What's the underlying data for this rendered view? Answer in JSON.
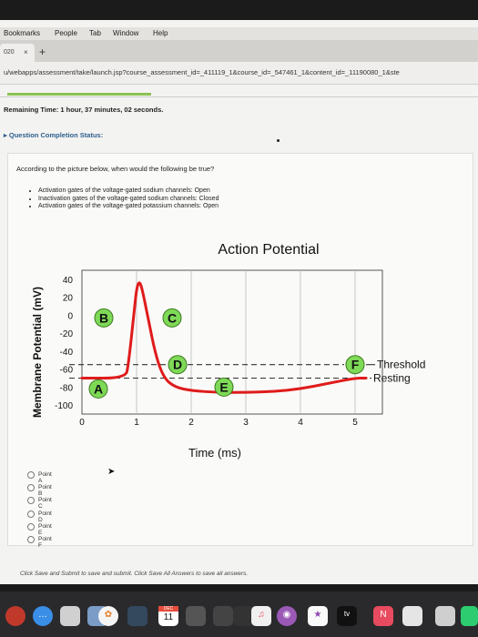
{
  "menubar": [
    "Bookmarks",
    "People",
    "Tab",
    "Window",
    "Help"
  ],
  "tab": {
    "label": "020",
    "close": "×",
    "new_tab": "+"
  },
  "url": "u/webapps/assessment/take/launch.jsp?course_assessment_id=_411119_1&course_id=_547461_1&content_id=_11190080_1&ste",
  "remaining_label": "Remaining Time:",
  "remaining_value": "1 hour, 37 minutes, 02 seconds.",
  "completion_label": "Question Completion Status:",
  "question": {
    "prompt": "According to the picture below, when would the following be true?",
    "conditions": [
      "Activation gates of the voltage-gated sodium channels: Open",
      "Inactivation gates of the voltage-gated sodium channels: Closed",
      "Activation gates of the voltage-gated potassium channels: Open"
    ],
    "options": [
      "Point A",
      "Point B",
      "Point C",
      "Point D",
      "Point E",
      "Point F"
    ]
  },
  "chart_data": {
    "type": "line",
    "title": "Action Potential",
    "xlabel": "Time (ms)",
    "ylabel": "Membrane Potential (mV)",
    "xlim": [
      0,
      5.5
    ],
    "ylim": [
      -110,
      50
    ],
    "x_ticks": [
      "0",
      "1",
      "2",
      "3",
      "4",
      "5"
    ],
    "y_ticks": [
      "40",
      "20",
      "0",
      "-20",
      "-40",
      "-60",
      "-80",
      "-100"
    ],
    "threshold_mV": -55,
    "resting_mV": -70,
    "threshold_label": "Threshold",
    "resting_label": "Resting",
    "curve_color": "#e01b1b",
    "label_color": "#7ed957",
    "points": [
      {
        "label": "A",
        "x": 0.3,
        "y": -82
      },
      {
        "label": "B",
        "x": 0.4,
        "y": -3
      },
      {
        "label": "C",
        "x": 1.65,
        "y": -3
      },
      {
        "label": "D",
        "x": 1.75,
        "y": -55
      },
      {
        "label": "E",
        "x": 2.6,
        "y": -80
      },
      {
        "label": "F",
        "x": 5.0,
        "y": -55
      }
    ],
    "curve": [
      [
        0,
        -70
      ],
      [
        0.8,
        -70
      ],
      [
        0.85,
        -55
      ],
      [
        0.95,
        0
      ],
      [
        1.0,
        30
      ],
      [
        1.05,
        38
      ],
      [
        1.1,
        30
      ],
      [
        1.2,
        0
      ],
      [
        1.35,
        -45
      ],
      [
        1.5,
        -70
      ],
      [
        1.7,
        -80
      ],
      [
        2.0,
        -84
      ],
      [
        2.5,
        -86
      ],
      [
        3.0,
        -86
      ],
      [
        3.5,
        -85
      ],
      [
        4.0,
        -82
      ],
      [
        4.5,
        -76
      ],
      [
        5.0,
        -70
      ],
      [
        5.2,
        -70
      ]
    ]
  },
  "footer_note": "Click Save and Submit to save and submit. Click Save All Answers to save all answers.",
  "dock_calendar": {
    "month": "DEC",
    "day": "11"
  },
  "dock_tv_label": "tv"
}
